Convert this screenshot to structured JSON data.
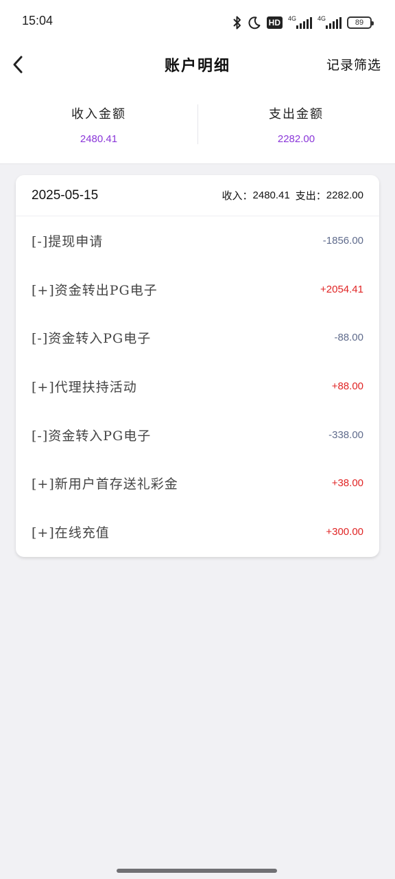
{
  "status_bar": {
    "time": "15:04",
    "hd_label": "HD",
    "signal_1_label": "4G",
    "signal_2_label": "4G",
    "battery_level": "89"
  },
  "header": {
    "back_icon": "chevron-left-icon",
    "title": "账户明细",
    "filter_label": "记录筛选"
  },
  "summary": {
    "income_label": "收入金额",
    "income_value": "2480.41",
    "expense_label": "支出金额",
    "expense_value": "2282.00"
  },
  "card": {
    "date": "2025-05-15",
    "income_label": "收入：",
    "income_value": "2480.41",
    "expense_label": "支出：",
    "expense_value": "2282.00",
    "rows": [
      {
        "label": "[-]提现申请",
        "amount": "-1856.00",
        "kind": "debit"
      },
      {
        "label": "[+]资金转出PG电子",
        "amount": "+2054.41",
        "kind": "credit"
      },
      {
        "label": "[-]资金转入PG电子",
        "amount": "-88.00",
        "kind": "debit"
      },
      {
        "label": "[+]代理扶持活动",
        "amount": "+88.00",
        "kind": "credit"
      },
      {
        "label": "[-]资金转入PG电子",
        "amount": "-338.00",
        "kind": "debit"
      },
      {
        "label": "[+]新用户首存送礼彩金",
        "amount": "+38.00",
        "kind": "credit"
      },
      {
        "label": "[+]在线充值",
        "amount": "+300.00",
        "kind": "credit"
      }
    ]
  },
  "colors": {
    "accent_purple": "#8a36d9",
    "credit_red": "#e02424",
    "debit_slate": "#5f6b8c",
    "page_bg": "#f1f1f4"
  }
}
